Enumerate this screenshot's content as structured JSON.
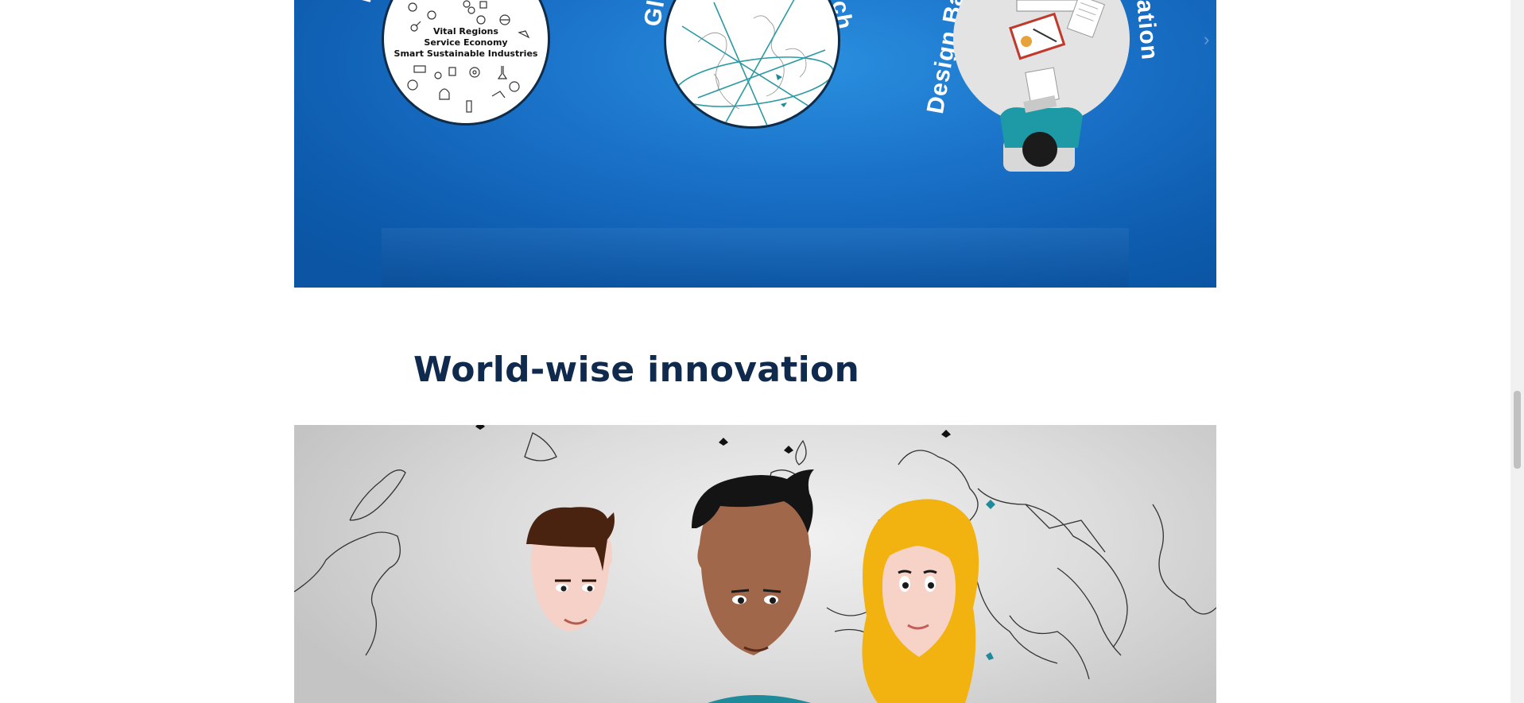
{
  "hero": {
    "circle1": {
      "arc_text": "Fo",
      "lines": [
        "Vital Regions",
        "Service Economy",
        "Smart Sustainable Industries"
      ]
    },
    "circle2": {
      "arc_text_left": "Gl",
      "arc_text_right": "ch"
    },
    "circle3": {
      "arc_text_left": "Design Ba",
      "arc_text_right": "ation"
    },
    "next_glyph": "›"
  },
  "section": {
    "title": "World-wise innovation"
  },
  "colors": {
    "panel_blue": "#1a72c8",
    "heading": "#0f2a4d",
    "teal_accent": "#1f8a9a",
    "map_gray": "#d6d6d6"
  }
}
